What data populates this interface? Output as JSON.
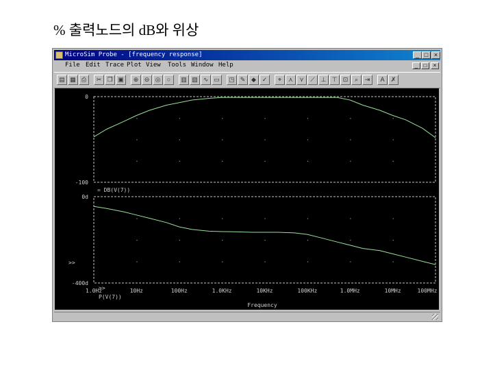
{
  "slide": {
    "title": "% 출력노드의 dB와 위상"
  },
  "window": {
    "title": "MicroSim Probe - [frequency response]",
    "controls": {
      "minimize": "_",
      "maximize": "□",
      "close": "×"
    }
  },
  "menu": {
    "items": [
      "File",
      "Edit",
      "Trace",
      "Plot",
      "View",
      "Tools",
      "Window",
      "Help"
    ],
    "mdi": [
      "_",
      "□",
      "×"
    ]
  },
  "toolbar": {
    "buttons": [
      {
        "name": "open-file-icon",
        "glyph": "▤"
      },
      {
        "name": "save-icon",
        "glyph": "▦"
      },
      {
        "name": "print-icon",
        "glyph": "⎙"
      },
      {
        "name": "cut-icon",
        "glyph": "✂"
      },
      {
        "name": "copy-icon",
        "glyph": "❐"
      },
      {
        "name": "paste-icon",
        "glyph": "▣"
      },
      {
        "name": "zoom-in-icon",
        "glyph": "⊕"
      },
      {
        "name": "zoom-out-icon",
        "glyph": "⊖"
      },
      {
        "name": "zoom-area-icon",
        "glyph": "◎"
      },
      {
        "name": "zoom-fit-icon",
        "glyph": "○"
      },
      {
        "name": "log-axis-icon",
        "glyph": "▥"
      },
      {
        "name": "fft-icon",
        "glyph": "▧"
      },
      {
        "name": "add-trace-icon",
        "glyph": "∿"
      },
      {
        "name": "add-plot-icon",
        "glyph": "▭"
      },
      {
        "name": "eval-goal-icon",
        "glyph": "◳"
      },
      {
        "name": "macro-icon",
        "glyph": "✎"
      },
      {
        "name": "color-icon",
        "glyph": "◆"
      },
      {
        "name": "mark-label-icon",
        "glyph": "✓"
      },
      {
        "name": "cursor-icon",
        "glyph": "⌖"
      },
      {
        "name": "cursor-peak-icon",
        "glyph": "⋏"
      },
      {
        "name": "cursor-trough-icon",
        "glyph": "⋎"
      },
      {
        "name": "cursor-slope-icon",
        "glyph": "⟋"
      },
      {
        "name": "cursor-min-icon",
        "glyph": "⊥"
      },
      {
        "name": "cursor-max-icon",
        "glyph": "⊤"
      },
      {
        "name": "cursor-point-icon",
        "glyph": "⊡"
      },
      {
        "name": "cursor-search-icon",
        "glyph": "⌕"
      },
      {
        "name": "cursor-next-icon",
        "glyph": "⇥"
      },
      {
        "name": "text-label-icon",
        "glyph": "A"
      },
      {
        "name": "markers-icon",
        "glyph": "✗"
      }
    ]
  },
  "colors": {
    "trace": "#9be09b",
    "axes": "#c8c8c8",
    "grid": "#9a9a9a",
    "label": "#d0d0d0",
    "background": "#000000"
  },
  "chart_data": [
    {
      "type": "line",
      "xscale": "log",
      "xlim": [
        1,
        100000000
      ],
      "ylim": [
        -100,
        0
      ],
      "ytick_labels": [
        "0",
        "-100"
      ],
      "trace_label": "= DB(V(7))",
      "series": [
        {
          "name": "DB(V(7))",
          "x": [
            1,
            2,
            5,
            10,
            20,
            50,
            100,
            200,
            500,
            1000,
            2000,
            5000,
            10000,
            20000,
            50000,
            100000,
            200000,
            500000,
            1000000,
            2000000,
            5000000,
            10000000,
            20000000,
            50000000,
            100000000
          ],
          "y": [
            -47,
            -38,
            -29,
            -22,
            -16,
            -10,
            -7,
            -4,
            -2,
            -1,
            -1,
            -1,
            -1,
            -1,
            -1,
            -1,
            -1,
            -1,
            -4,
            -10,
            -16,
            -22,
            -27,
            -37,
            -48
          ]
        }
      ]
    },
    {
      "type": "line",
      "xscale": "log",
      "xlim": [
        1,
        100000000
      ],
      "ylim": [
        -400,
        0
      ],
      "ytick_labels": [
        "0d",
        "-400d"
      ],
      "trace_label": "P(V(7))",
      "xtick_labels": [
        "1.0Hz",
        "10Hz",
        "100Hz",
        "1.0KHz",
        "10KHz",
        "100KHz",
        "1.0MHz",
        "10MHz",
        "100MHz"
      ],
      "xlabel": "Frequency",
      "series": [
        {
          "name": "P(V(7))",
          "x": [
            1,
            2,
            5,
            10,
            20,
            50,
            100,
            200,
            500,
            1000,
            2000,
            5000,
            10000,
            20000,
            50000,
            100000,
            200000,
            500000,
            1000000,
            2000000,
            5000000,
            10000000,
            20000000,
            50000000,
            100000000
          ],
          "y": [
            -45,
            -55,
            -70,
            -85,
            -100,
            -120,
            -140,
            -152,
            -160,
            -162,
            -163,
            -165,
            -165,
            -165,
            -168,
            -175,
            -190,
            -210,
            -225,
            -240,
            -250,
            -265,
            -280,
            -300,
            -315
          ]
        }
      ]
    }
  ]
}
